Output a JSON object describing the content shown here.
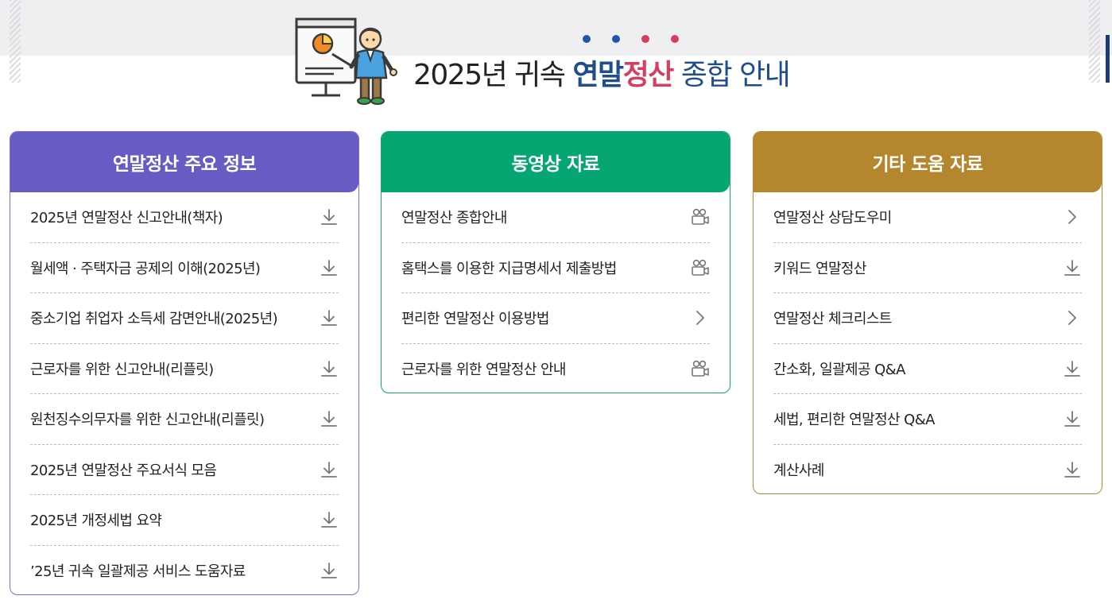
{
  "header": {
    "title_prefix": "2025년 귀속 ",
    "title_highlight_blue": "연말",
    "title_highlight_red": "정산",
    "title_suffix": " 종합 안내",
    "dot_colors": [
      "#1f57a8",
      "#1f57a8",
      "#d43f5e",
      "#d43f5e"
    ]
  },
  "panels": {
    "info": {
      "title": "연말정산 주요 정보",
      "color": "#675cc4",
      "items": [
        {
          "label": "2025년 연말정산 신고안내(책자)",
          "icon": "download-icon"
        },
        {
          "label": "월세액 · 주택자금 공제의 이해(2025년)",
          "icon": "download-icon"
        },
        {
          "label": "중소기업 취업자 소득세 감면안내(2025년)",
          "icon": "download-icon"
        },
        {
          "label": "근로자를 위한 신고안내(리플릿)",
          "icon": "download-icon"
        },
        {
          "label": "원천징수의무자를 위한 신고안내(리플릿)",
          "icon": "download-icon"
        },
        {
          "label": "2025년 연말정산 주요서식 모음",
          "icon": "download-icon"
        },
        {
          "label": "2025년 개정세법 요약",
          "icon": "download-icon"
        },
        {
          "label": "’25년 귀속 일괄제공 서비스 도움자료",
          "icon": "download-icon"
        }
      ]
    },
    "video": {
      "title": "동영상 자료",
      "color": "#06a672",
      "items": [
        {
          "label": "연말정산 종합안내",
          "icon": "video-camera-icon"
        },
        {
          "label": "홈택스를 이용한 지급명세서 제출방법",
          "icon": "video-camera-icon"
        },
        {
          "label": "편리한 연말정산 이용방법",
          "icon": "chevron-right-icon"
        },
        {
          "label": "근로자를 위한 연말정산 안내",
          "icon": "video-camera-icon"
        }
      ]
    },
    "etc": {
      "title": "기타 도움 자료",
      "color": "#b4862e",
      "items": [
        {
          "label": "연말정산 상담도우미",
          "icon": "chevron-right-icon"
        },
        {
          "label": "키워드 연말정산",
          "icon": "download-icon"
        },
        {
          "label": "연말정산 체크리스트",
          "icon": "chevron-right-icon"
        },
        {
          "label": "간소화, 일괄제공 Q&A",
          "icon": "download-icon"
        },
        {
          "label": "세법, 편리한 연말정산 Q&A",
          "icon": "download-icon"
        },
        {
          "label": "계산사례",
          "icon": "download-icon"
        }
      ]
    }
  }
}
